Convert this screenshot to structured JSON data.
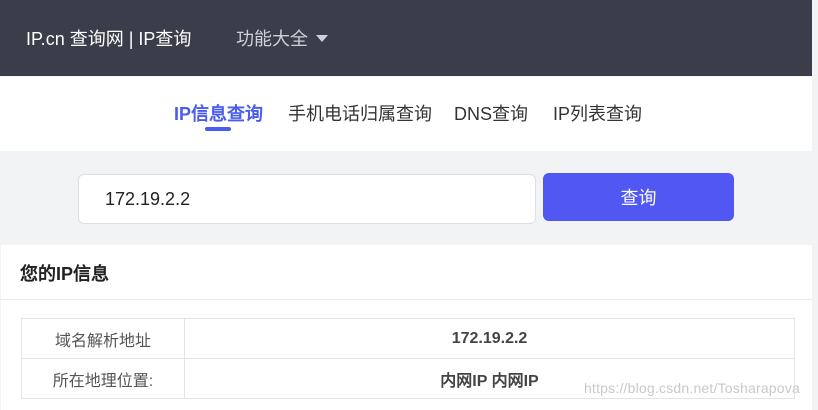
{
  "header": {
    "brand": "IP.cn 查询网 | IP查询",
    "menu_all": "功能大全"
  },
  "tabs": [
    {
      "label": "IP信息查询",
      "active": true
    },
    {
      "label": "手机电话归属查询",
      "active": false
    },
    {
      "label": "DNS查询",
      "active": false
    },
    {
      "label": "IP列表查询",
      "active": false
    }
  ],
  "search": {
    "value": "172.19.2.2",
    "button_label": "查询"
  },
  "panel": {
    "title": "您的IP信息",
    "rows": [
      {
        "key": "域名解析地址",
        "value": "172.19.2.2"
      },
      {
        "key": "所在地理位置:",
        "value": "内网IP 内网IP"
      }
    ]
  },
  "watermark": "https://blog.csdn.net/Tosharapova",
  "colors": {
    "accent": "#4a5cf0",
    "button": "#5057f2",
    "topbar": "#3b3e4a"
  },
  "icons": {
    "menu_caret": "caret-down-icon"
  }
}
